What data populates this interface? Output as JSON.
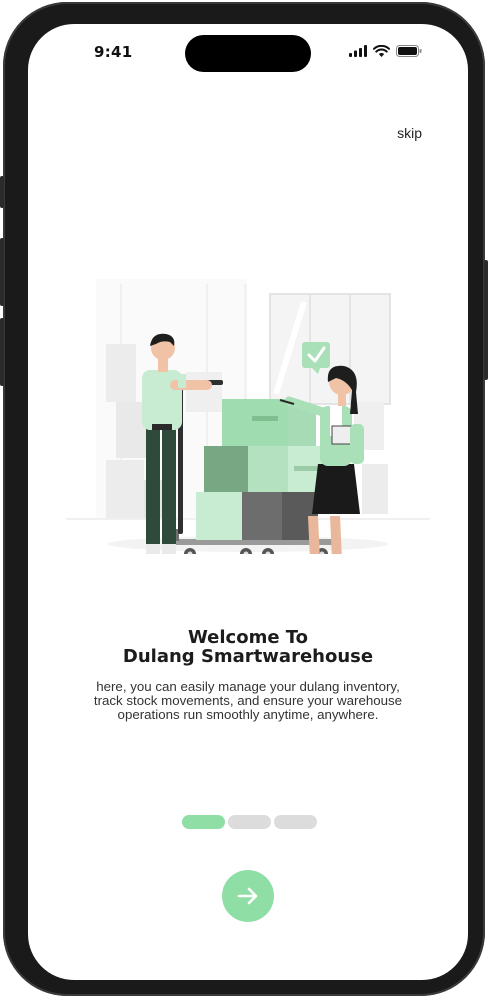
{
  "status_bar": {
    "time": "9:41",
    "icons": [
      "signal-icon",
      "wifi-icon",
      "battery-icon"
    ]
  },
  "onboarding": {
    "skip_label": "skip",
    "illustration": "warehouse-workers-illustration",
    "title_line1": "Welcome To",
    "title_line2": "Dulang Smartwarehouse",
    "description": "here, you can easily manage your dulang inventory, track stock movements, and ensure your warehouse operations run smoothly anytime, anywhere.",
    "pagination": {
      "total": 3,
      "current": 1
    },
    "next_icon": "arrow-right-icon"
  },
  "colors": {
    "accent": "#8fdea6",
    "inactive_dot": "#dcdcdc",
    "text": "#1c1c1c"
  }
}
